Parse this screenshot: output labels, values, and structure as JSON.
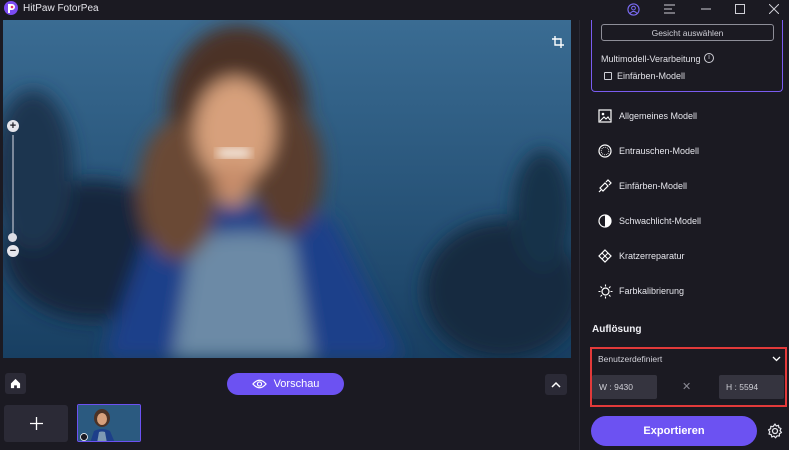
{
  "app": {
    "title": "HitPaw FotorPea"
  },
  "panel": {
    "select_face_label": "Gesicht auswählen",
    "multi_model_label": "Multimodell-Verarbeitung",
    "multi_model_checkbox_label": "Einfärben-Modell",
    "models": [
      {
        "label": "Allgemeines Modell",
        "icon": "image-icon"
      },
      {
        "label": "Entrauschen-Modell",
        "icon": "denoise-icon"
      },
      {
        "label": "Einfärben-Modell",
        "icon": "colorize-icon"
      },
      {
        "label": "Schwachlicht-Modell",
        "icon": "lowlight-icon"
      },
      {
        "label": "Kratzerreparatur",
        "icon": "scratch-repair-icon"
      },
      {
        "label": "Farbkalibrierung",
        "icon": "color-calibration-icon"
      }
    ],
    "resolution": {
      "title": "Auflösung",
      "preset": "Benutzerdefiniert",
      "width": "W : 9430",
      "height": "H : 5594",
      "separator": "✕"
    },
    "export_label": "Exportieren"
  },
  "toolbar": {
    "preview_label": "Vorschau"
  },
  "colors": {
    "accent": "#6c52f2",
    "highlight": "#e23a3a",
    "background": "#1b1a22"
  }
}
